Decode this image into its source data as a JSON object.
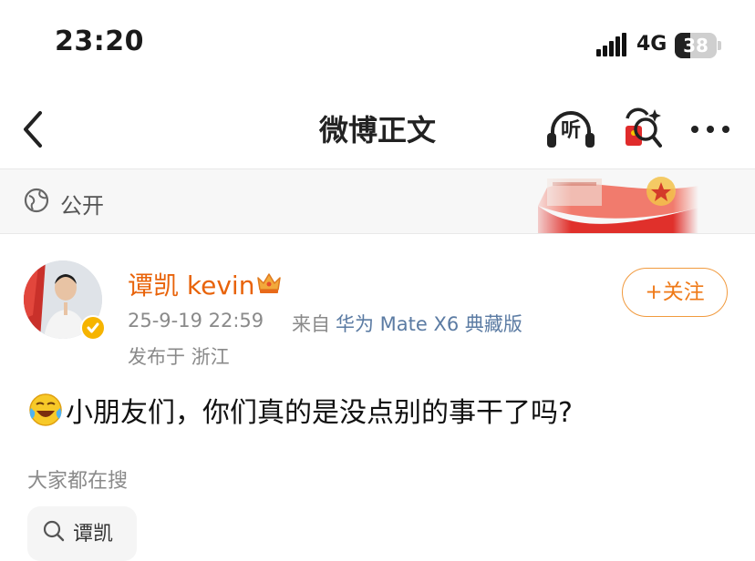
{
  "status_bar": {
    "time": "23:20",
    "network": "4G",
    "battery": "38",
    "battery_level": 0.38
  },
  "nav": {
    "title": "微博正文",
    "listen_label": "听"
  },
  "visibility": {
    "label": "公开"
  },
  "post": {
    "author": "谭凯 kevin",
    "time": "25-9-19 22:59",
    "source_prefix": "来自",
    "device": "华为 Mate X6 典藏版",
    "location": "发布于 浙江",
    "follow_label": "+关注",
    "text": "小朋友们，你们真的是没点别的事干了吗?"
  },
  "trends": {
    "label": "大家都在搜",
    "items": [
      "谭凯"
    ]
  },
  "colors": {
    "accent_orange": "#ef7a18",
    "link_blue": "#5b7ba3",
    "muted": "#8a8a8a"
  }
}
